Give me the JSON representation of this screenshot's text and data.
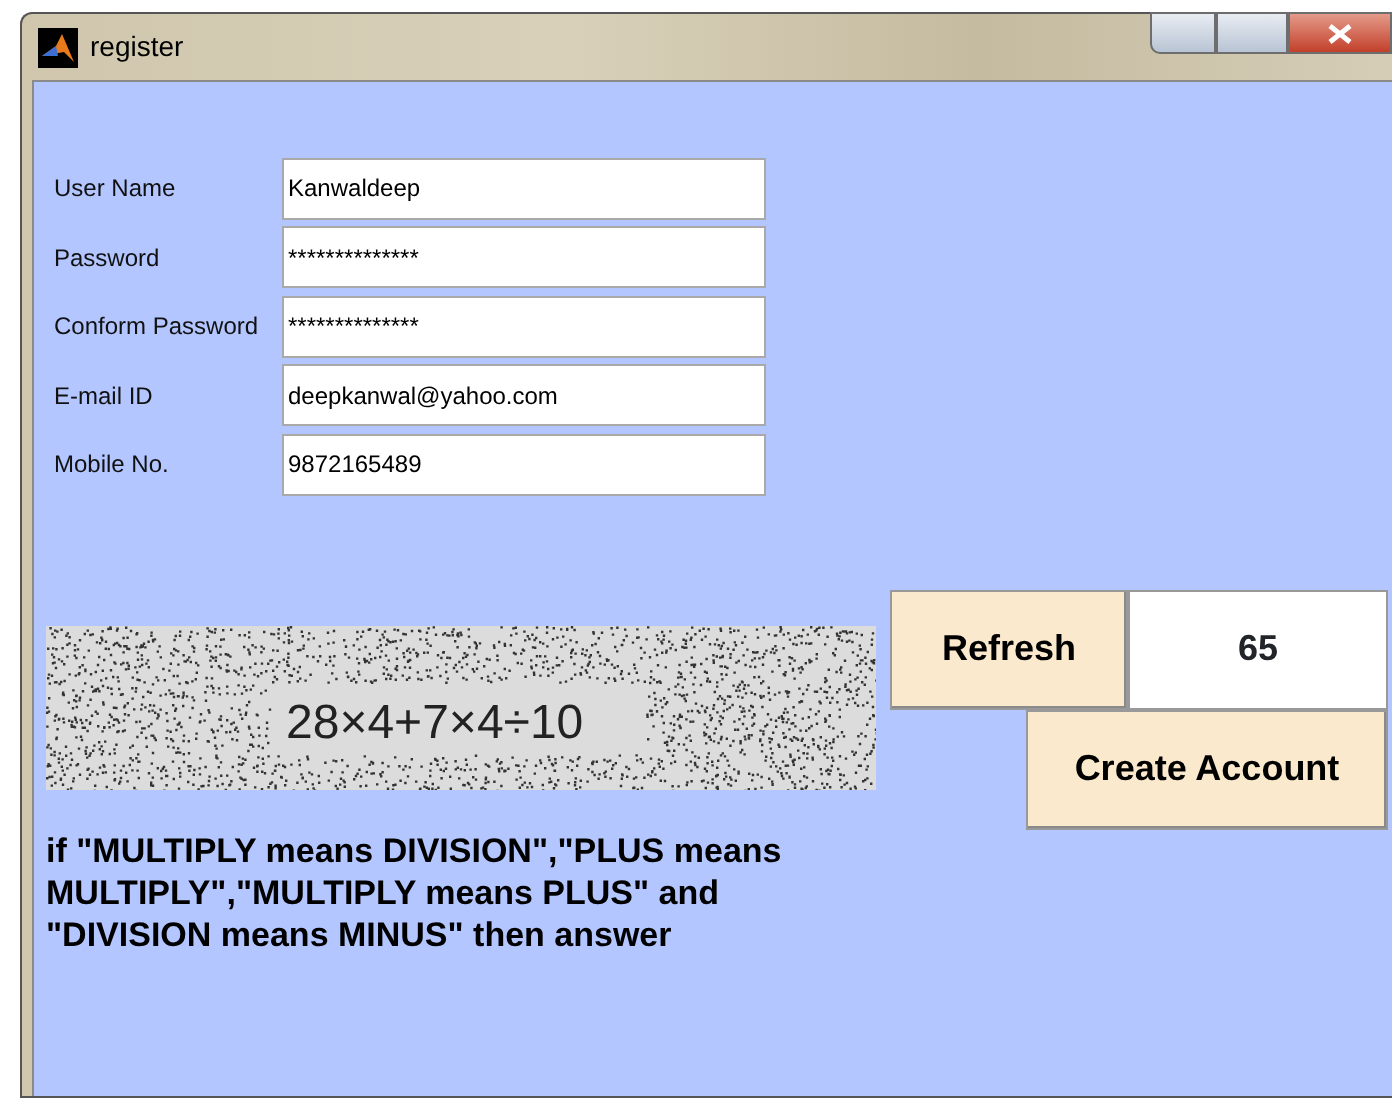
{
  "window": {
    "title": "register"
  },
  "fields": [
    {
      "label": "User Name",
      "value": "Kanwaldeep"
    },
    {
      "label": "Password",
      "value": "**************"
    },
    {
      "label": "Conform Password",
      "value": "**************"
    },
    {
      "label": "E-mail ID",
      "value": "deepkanwal@yahoo.com"
    },
    {
      "label": "Mobile No.",
      "value": "9872165489"
    }
  ],
  "captcha": {
    "expression": "28×4+7×4÷10"
  },
  "refresh_button": "Refresh",
  "answer": "65",
  "create_button": "Create Account",
  "instruction": "if \"MULTIPLY means DIVISION\",\"PLUS means MULTIPLY\",\"MULTIPLY means PLUS\" and \"DIVISION means MINUS\" then answer"
}
